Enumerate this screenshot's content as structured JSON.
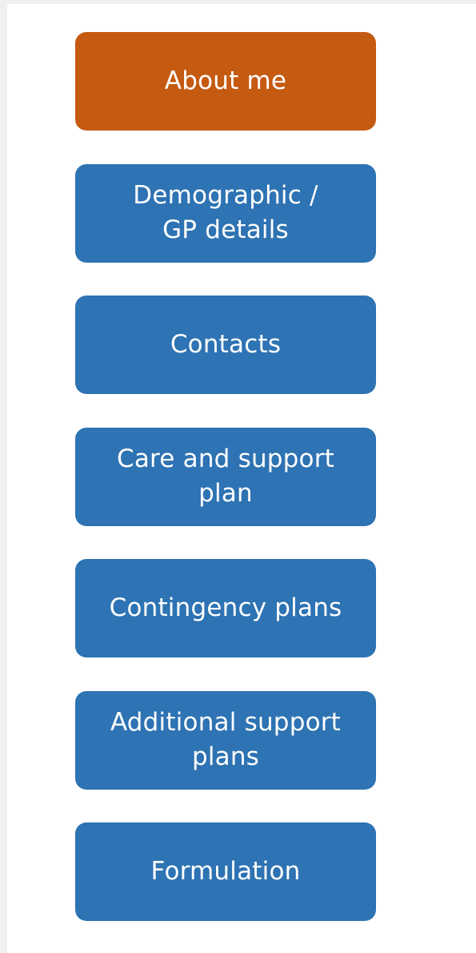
{
  "nav": {
    "items": [
      {
        "label": "About me",
        "active": true
      },
      {
        "label": "Demographic /\nGP details",
        "active": false
      },
      {
        "label": "Contacts",
        "active": false
      },
      {
        "label": "Care and support\nplan",
        "active": false
      },
      {
        "label": "Contingency plans",
        "active": false
      },
      {
        "label": "Additional support\nplans",
        "active": false
      },
      {
        "label": "Formulation",
        "active": false
      }
    ]
  },
  "colors": {
    "accent_active": "#c55a11",
    "accent_default": "#2e73b3",
    "text": "#ffffff"
  }
}
